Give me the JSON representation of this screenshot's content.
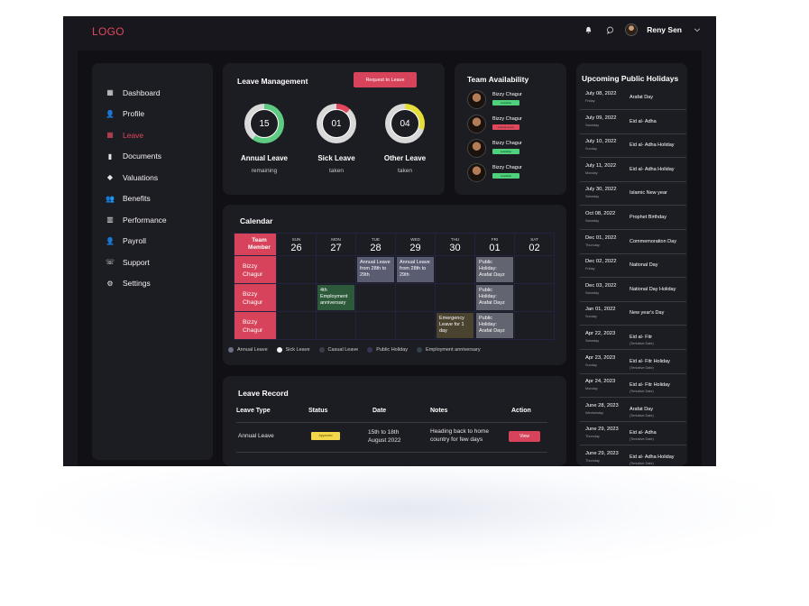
{
  "app": {
    "logo": "LOGO",
    "user_name": "Reny Sen"
  },
  "icons": {
    "notification": "bell-icon",
    "messages": "chat-bubble-icon",
    "dropdown": "chevron-down-icon"
  },
  "sidebar": {
    "items": [
      {
        "label": "Dashboard",
        "icon": "dashboard-grid-icon"
      },
      {
        "label": "Profile",
        "icon": "user-plus-icon"
      },
      {
        "label": "Leave",
        "icon": "calendar-icon",
        "active": true
      },
      {
        "label": "Documents",
        "icon": "document-icon"
      },
      {
        "label": "Valuations",
        "icon": "tag-icon"
      },
      {
        "label": "Benefits",
        "icon": "users-plus-icon"
      },
      {
        "label": "Performance",
        "icon": "bar-chart-icon"
      },
      {
        "label": "Payroll",
        "icon": "user-plus-icon"
      },
      {
        "label": "Support",
        "icon": "support-icon"
      },
      {
        "label": "Settings",
        "icon": "gear-icon"
      }
    ]
  },
  "leave_management": {
    "title": "Leave Management",
    "request_button": "Request to Leave",
    "summaries": [
      {
        "value": "15",
        "label": "Annual Leave",
        "sub": "remaining",
        "color": "#5ecb82",
        "fraction": 0.6
      },
      {
        "value": "01",
        "label": "Sick Leave",
        "sub": "taken",
        "color": "#e2475d",
        "fraction": 0.12
      },
      {
        "value": "04",
        "label": "Other Leave",
        "sub": "taken",
        "color": "#e6dd3b",
        "fraction": 0.3
      }
    ]
  },
  "team_availability": {
    "title": "Team Availability",
    "members": [
      {
        "name": "Bizzy Chagur",
        "status": "Available",
        "status_color": "#4fd17c"
      },
      {
        "name": "Bizzy Chagur",
        "status": "Annual Leave",
        "status_color": "#e2475d"
      },
      {
        "name": "Bizzy Chagur",
        "status": "Available",
        "status_color": "#4fd17c"
      },
      {
        "name": "Bizzy Chagur",
        "status": "Available",
        "status_color": "#4fd17c"
      }
    ]
  },
  "holidays": {
    "title": "Upcoming Public Holidays",
    "items": [
      {
        "date": "July 08, 2022",
        "day": "Friday",
        "name": "Arafat Day",
        "note": ""
      },
      {
        "date": "July 09, 2022",
        "day": "Saturday",
        "name": "Eid al- Adha",
        "note": ""
      },
      {
        "date": "July 10, 2022",
        "day": "Sunday",
        "name": "Eid al- Adha Holiday",
        "note": ""
      },
      {
        "date": "July 11, 2022",
        "day": "Monday",
        "name": "Eid al- Adha Holiday",
        "note": ""
      },
      {
        "date": "July 30, 2022",
        "day": "Saturday",
        "name": "Islamic New year",
        "note": ""
      },
      {
        "date": "Oct 08, 2022",
        "day": "Saturday",
        "name": "Prophet Birthday",
        "note": ""
      },
      {
        "date": "Dec 01, 2022",
        "day": "Thursday",
        "name": "Commemoration Day",
        "note": ""
      },
      {
        "date": "Dec 02, 2022",
        "day": "Friday",
        "name": "National Day",
        "note": ""
      },
      {
        "date": "Dec 03, 2022",
        "day": "Saturday",
        "name": "National Day Holiday",
        "note": ""
      },
      {
        "date": "Jan 01, 2022",
        "day": "Sunday",
        "name": "New year's Day",
        "note": ""
      },
      {
        "date": "Apr 22, 2023",
        "day": "Saturday",
        "name": "Eid al- Fitr",
        "note": "(Tentative Date)"
      },
      {
        "date": "Apr 23, 2023",
        "day": "Sunday",
        "name": "Eid al- Fitr Holiday",
        "note": "(Tentative Date)"
      },
      {
        "date": "Apr 24, 2023",
        "day": "Monday",
        "name": "Eid al- Fitr Holiday",
        "note": "(Tentative Date)"
      },
      {
        "date": "June 28, 2023",
        "day": "Wednesday",
        "name": "Arafat Day",
        "note": "(Tentative Date)"
      },
      {
        "date": "June 29, 2023",
        "day": "Thursday",
        "name": "Eid al- Adha",
        "note": "(Tentative Date)"
      },
      {
        "date": "June 29, 2023",
        "day": "Thursday",
        "name": "Eid al- Adha Holiday",
        "note": "(Tentative Date)"
      }
    ]
  },
  "calendar": {
    "title": "Calendar",
    "team_header": "Team Member",
    "days": [
      {
        "name": "SUN",
        "num": "26"
      },
      {
        "name": "MON",
        "num": "27"
      },
      {
        "name": "TUE",
        "num": "28"
      },
      {
        "name": "WED",
        "num": "29"
      },
      {
        "name": "THU",
        "num": "30"
      },
      {
        "name": "FRI",
        "num": "01"
      },
      {
        "name": "SAT",
        "num": "02"
      }
    ],
    "rows": [
      {
        "member": "Bizzy Chagur",
        "events": [
          {
            "day": 2,
            "text": "Annual Leave from 28th to 29th",
            "color": "#5a5d72"
          },
          {
            "day": 3,
            "text": "Annual Leave from 28th to 29th",
            "color": "#5a5d72"
          },
          {
            "day": 5,
            "text": "Public Holiday: Arafat Dayz",
            "color": "#62646f"
          }
        ]
      },
      {
        "member": "Bizzy Chagur",
        "events": [
          {
            "day": 1,
            "text": "4th Employment anniversary",
            "color": "#2d5a3b"
          },
          {
            "day": 5,
            "text": "Public Holiday: Arafat Dayz",
            "color": "#62646f"
          }
        ]
      },
      {
        "member": "Bizzy Chagur",
        "events": [
          {
            "day": 4,
            "text": "Emergency Leave for 1 day",
            "color": "#4a4330"
          },
          {
            "day": 5,
            "text": "Public Holiday: Arafat Dayz",
            "color": "#62646f"
          }
        ]
      }
    ],
    "legend": [
      {
        "label": "Annual Leave",
        "color": "#6c6f86"
      },
      {
        "label": "Sick Leave",
        "color": "#f4f4f4"
      },
      {
        "label": "Casual Leave",
        "color": "#3b3d4a"
      },
      {
        "label": "Public Holiday",
        "color": "#3a3358"
      },
      {
        "label": "Employment anniversary",
        "color": "#33404a"
      }
    ]
  },
  "leave_record": {
    "title": "Leave Record",
    "headers": {
      "type": "Leave Type",
      "status": "Status",
      "date": "Date",
      "notes": "Notes",
      "action": "Action"
    },
    "rows": [
      {
        "type": "Annual Leave",
        "status": "Approved",
        "date": "15th to 18th August 2022",
        "notes": "Heading back to home country for few days",
        "action": "View"
      }
    ]
  }
}
